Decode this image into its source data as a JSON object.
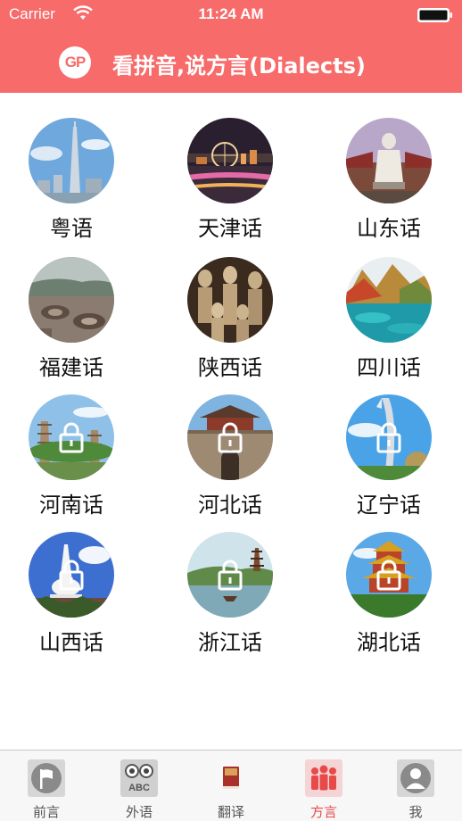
{
  "status_bar": {
    "carrier": "Carrier",
    "time": "11:24 AM"
  },
  "header": {
    "logo_text": "GP",
    "title": "看拼音,说方言(Dialects)"
  },
  "dialects": [
    {
      "label": "粤语",
      "locked": false,
      "scene": "canton-tower"
    },
    {
      "label": "天津话",
      "locked": false,
      "scene": "tianjin-eye-night"
    },
    {
      "label": "山东话",
      "locked": false,
      "scene": "confucius-statue"
    },
    {
      "label": "福建话",
      "locked": false,
      "scene": "tulou-village"
    },
    {
      "label": "陕西话",
      "locked": false,
      "scene": "terracotta-warriors"
    },
    {
      "label": "四川话",
      "locked": false,
      "scene": "jiuzhaigou-lake"
    },
    {
      "label": "河南话",
      "locked": true,
      "scene": "pagoda-forest"
    },
    {
      "label": "河北话",
      "locked": true,
      "scene": "great-wall-gate"
    },
    {
      "label": "辽宁话",
      "locked": true,
      "scene": "sculpture-park"
    },
    {
      "label": "山西话",
      "locked": true,
      "scene": "white-pagoda"
    },
    {
      "label": "浙江话",
      "locked": true,
      "scene": "west-lake"
    },
    {
      "label": "湖北话",
      "locked": true,
      "scene": "yellow-crane-tower"
    }
  ],
  "tabs": [
    {
      "label": "前言",
      "icon": "flag-icon",
      "active": false
    },
    {
      "label": "外语",
      "icon": "owl-abc-icon",
      "active": false
    },
    {
      "label": "翻译",
      "icon": "dictionary-book-icon",
      "active": false
    },
    {
      "label": "方言",
      "icon": "people-group-icon",
      "active": true
    },
    {
      "label": "我",
      "icon": "user-profile-icon",
      "active": false
    }
  ],
  "colors": {
    "header_bg": "#f76b6b",
    "active_tab": "#e84a4a",
    "inactive_tab": "#555555"
  }
}
